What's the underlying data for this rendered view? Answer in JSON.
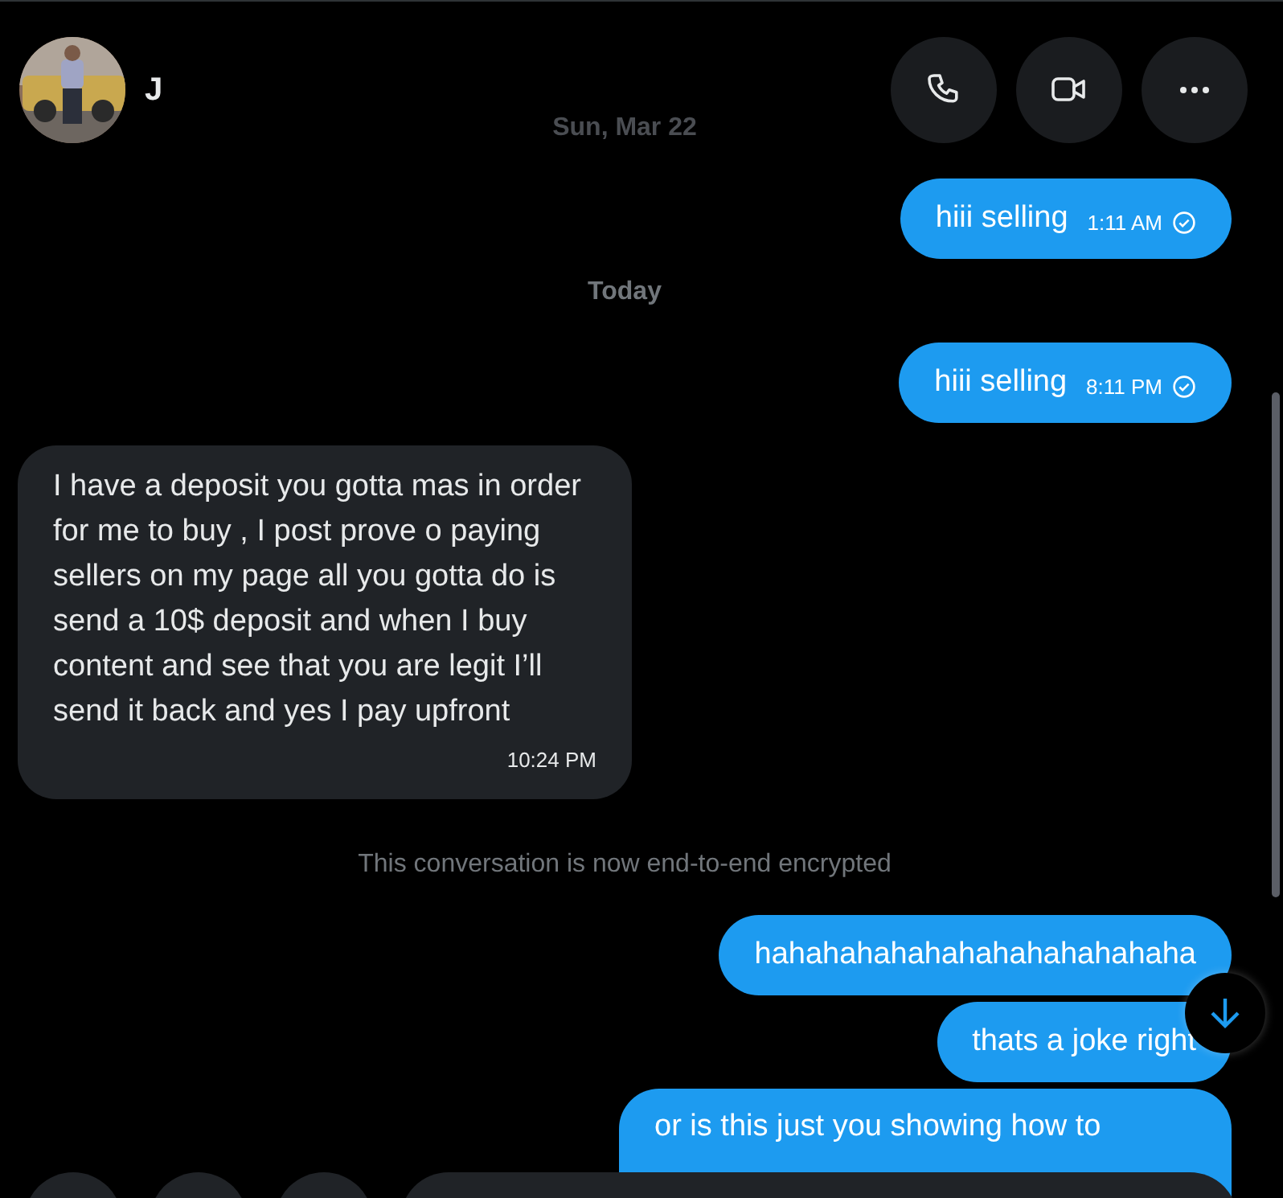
{
  "header": {
    "name": "J",
    "buttons": [
      {
        "kind": "call"
      },
      {
        "kind": "video"
      },
      {
        "kind": "more"
      }
    ]
  },
  "messages": [
    {
      "kind": "date",
      "text": "Sun, Mar 22",
      "faded": true
    },
    {
      "kind": "sent",
      "text": "hiii selling",
      "time": "1:11 AM",
      "read": true
    },
    {
      "kind": "date",
      "text": "Today",
      "faded": false
    },
    {
      "kind": "sent",
      "text": "hiii selling",
      "time": "8:11 PM",
      "read": true
    },
    {
      "kind": "received",
      "text": "I have a deposit you gotta mas in order for me to buy , I post prove o paying sellers on my page all you gotta do is send a 10$ deposit and when I buy content and see that you are legit I’ll send it back and yes I pay upfront",
      "time": "10:24 PM"
    },
    {
      "kind": "notice",
      "text": "This conversation is now end-to-end encrypted"
    },
    {
      "kind": "sent",
      "text": "hahahahahahahahahahahahaha"
    },
    {
      "kind": "sent",
      "text": "thats a joke right"
    },
    {
      "kind": "sent",
      "text": "or is this just you showing how to"
    }
  ]
}
